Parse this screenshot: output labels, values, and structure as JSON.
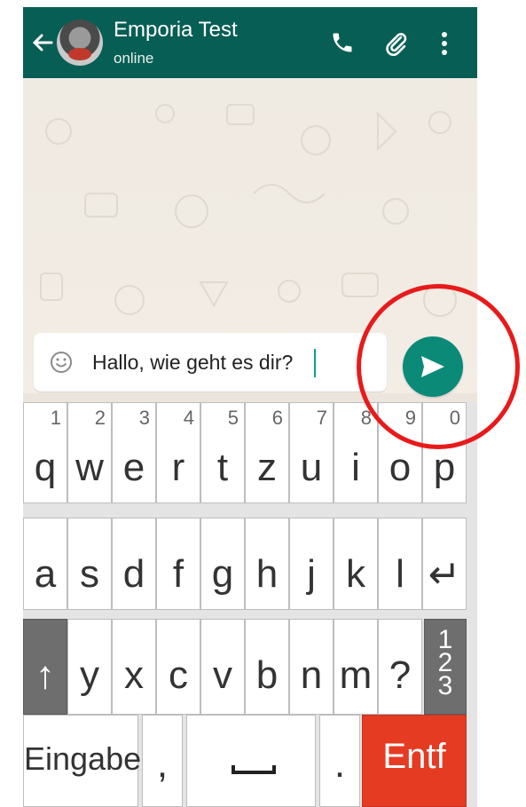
{
  "header": {
    "contact_name": "Emporia Test",
    "status": "online",
    "back_icon": "arrow-left-icon",
    "call_icon": "phone-icon",
    "attach_icon": "paperclip-icon",
    "menu_icon": "more-vertical-icon",
    "bg_color": "#075e54"
  },
  "composer": {
    "message_value": "Hallo, wie geht es dir?",
    "emoji_icon": "smiley-icon",
    "send_icon": "send-icon",
    "send_color": "#0b8a78"
  },
  "keyboard": {
    "row1": [
      {
        "key": "q",
        "num": "1"
      },
      {
        "key": "w",
        "num": "2"
      },
      {
        "key": "e",
        "num": "3"
      },
      {
        "key": "r",
        "num": "4"
      },
      {
        "key": "t",
        "num": "5"
      },
      {
        "key": "z",
        "num": "6"
      },
      {
        "key": "u",
        "num": "7"
      },
      {
        "key": "i",
        "num": "8"
      },
      {
        "key": "o",
        "num": "9"
      },
      {
        "key": "p",
        "num": "0"
      }
    ],
    "row2": [
      "a",
      "s",
      "d",
      "f",
      "g",
      "h",
      "j",
      "k",
      "l",
      "↵"
    ],
    "row3": [
      "↑",
      "y",
      "x",
      "c",
      "v",
      "b",
      "n",
      "m",
      "?",
      "1\n2\n3"
    ],
    "row4": {
      "enter_label": "Eingabe",
      "comma_label": ",",
      "period_label": ".",
      "delete_label": "Entf"
    },
    "delete_color": "#e53b23",
    "shift_color": "#6e6e6e"
  },
  "annotation": {
    "color": "#e81a1a",
    "target": "send-button"
  }
}
